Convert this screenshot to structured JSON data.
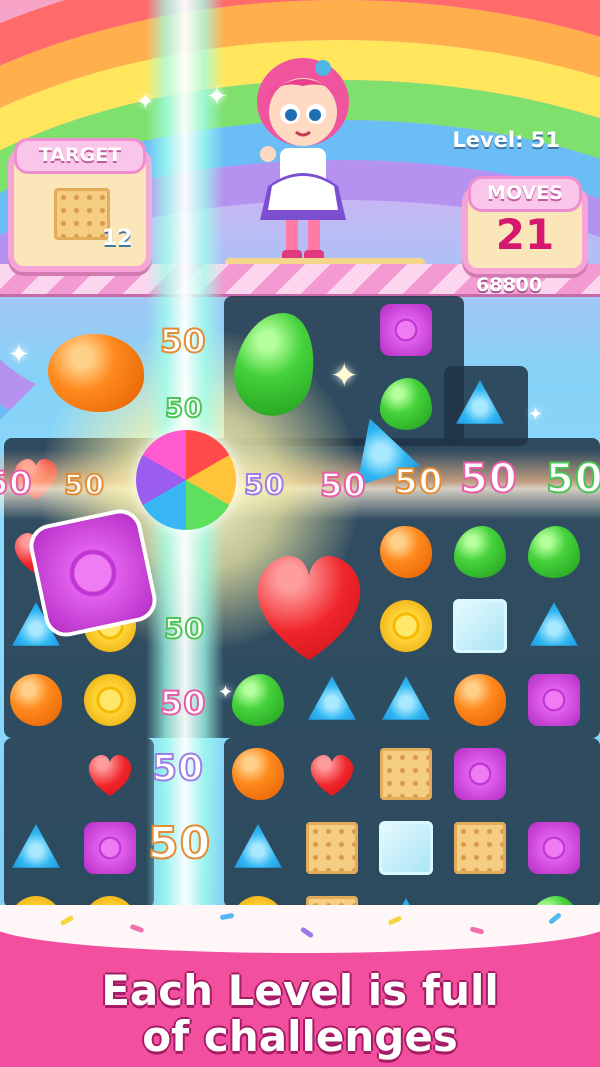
{
  "hud": {
    "target_label": "TARGET",
    "target_count": "12",
    "level_label": "Level: 51",
    "moves_label": "MOVES",
    "moves_value": "21",
    "score": "68800"
  },
  "popups": [
    "50",
    "50",
    "50",
    "50",
    "50",
    "50",
    "50",
    "50",
    "50",
    "50",
    "50",
    "50",
    "50"
  ],
  "tagline": {
    "line1": "Each Level is full",
    "line2": "of challenges"
  },
  "colors": {
    "brand_pink": "#f24f9f",
    "board": "#203446",
    "panel_border": "#f6a3d6"
  },
  "icons": [
    "target-cookie-icon",
    "star-sparkle-icon",
    "rainbow-candy-icon",
    "heart-candy-icon"
  ]
}
